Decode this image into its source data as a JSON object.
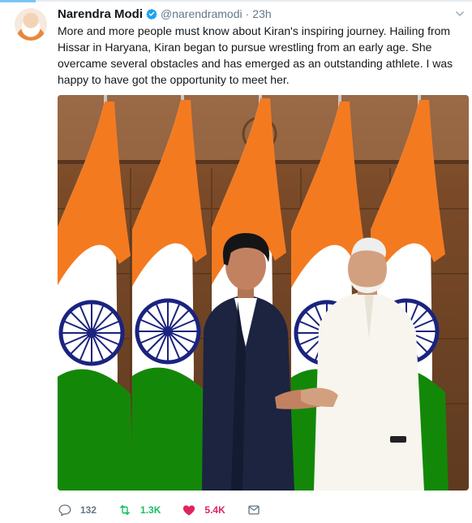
{
  "tweet": {
    "author_name": "Narendra Modi",
    "handle": "@narendramodi",
    "separator": "·",
    "time": "23h",
    "text": "More and more people must know about Kiran's inspiring journey. Hailing from Hissar in Haryana, Kiran began to pursue wrestling from an early age. She overcame several obstacles and has emerged as an outstanding athlete. I was happy to have got the opportunity to meet her."
  },
  "actions": {
    "replies": "132",
    "retweets": "1.3K",
    "likes": "5.4K"
  },
  "icons": [
    "avatar",
    "verified-badge-icon",
    "caret-down-icon",
    "reply-icon",
    "retweet-icon",
    "heart-icon",
    "message-icon"
  ],
  "colors": {
    "brand": "#1da1f2",
    "retweet": "#17bf63",
    "like": "#e0245e",
    "muted": "#657786",
    "saffron": "#f47a20",
    "flag_green": "#138808",
    "chakra_navy": "#1a237e"
  }
}
